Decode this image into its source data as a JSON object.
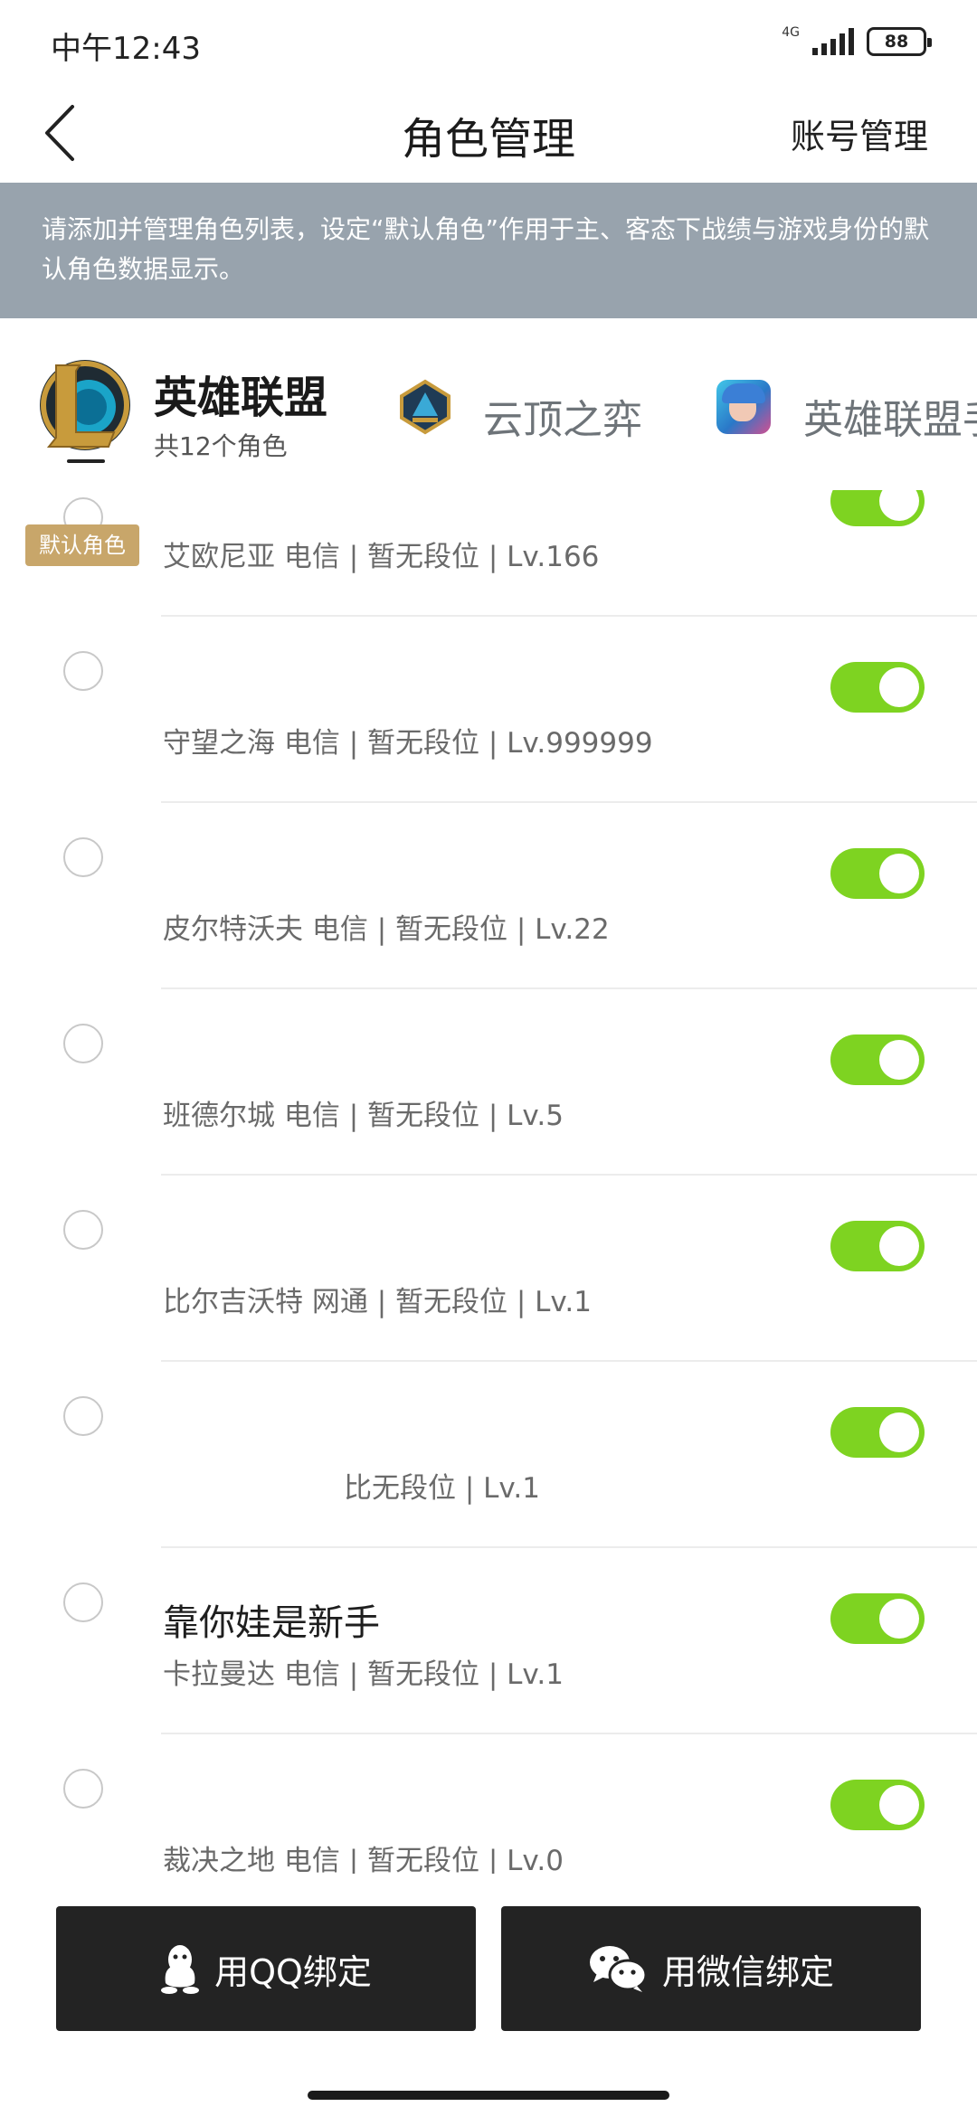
{
  "status_bar": {
    "time": "中午12:43",
    "network": "4G",
    "battery": "88"
  },
  "header": {
    "title": "角色管理",
    "account_link": "账号管理"
  },
  "notice": {
    "text": "请添加并管理角色列表，设定“默认角色”作用于主、客态下战绩与游戏身份的默认角色数据显示。"
  },
  "game_tabs": [
    {
      "name": "英雄联盟",
      "subtitle": "共12个角色",
      "selected": true,
      "icon": "league-of-legends-logo"
    },
    {
      "name": "云顶之弈",
      "selected": false,
      "icon": "teamfight-tactics-icon"
    },
    {
      "name": "英雄联盟手",
      "selected": false,
      "icon": "wild-rift-icon"
    }
  ],
  "default_badge": "默认角色",
  "roles": [
    {
      "name": "",
      "info": "艾欧尼亚 电信 | 暂无段位 | Lv.166",
      "enabled": true,
      "default": true
    },
    {
      "name": "",
      "info": "守望之海 电信 | 暂无段位 | Lv.999999",
      "enabled": true,
      "default": false
    },
    {
      "name": "",
      "info": "皮尔特沃夫 电信 | 暂无段位 | Lv.22",
      "enabled": true,
      "default": false
    },
    {
      "name": "",
      "info": "班德尔城 电信 | 暂无段位 | Lv.5",
      "enabled": true,
      "default": false
    },
    {
      "name": "",
      "info": "比尔吉沃特 网通 | 暂无段位 | Lv.1",
      "enabled": true,
      "default": false
    },
    {
      "name": "",
      "info": "比无段位 | Lv.1",
      "enabled": true,
      "default": false
    },
    {
      "name": "靠你娃是新手",
      "info": "卡拉曼达 电信 | 暂无段位 | Lv.1",
      "enabled": true,
      "default": false
    },
    {
      "name": "",
      "info": "裁决之地 电信 | 暂无段位 | Lv.0",
      "enabled": true,
      "default": false
    }
  ],
  "buttons": {
    "qq_bind": "用QQ绑定",
    "wechat_bind": "用微信绑定"
  },
  "colors": {
    "toggle_on": "#7ed321",
    "notice_bg": "#98a3ad",
    "default_badge": "#c8a66a",
    "bind_button": "#232323"
  }
}
